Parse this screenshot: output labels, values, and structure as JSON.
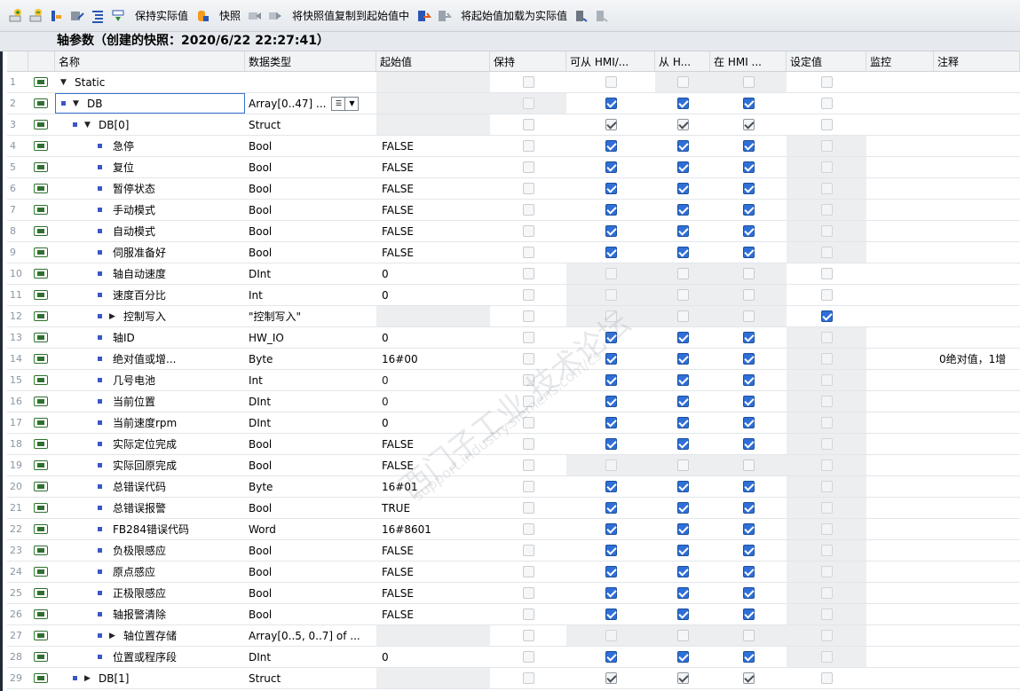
{
  "toolbar": {
    "icons": [
      "insert-row-icon",
      "add-row-icon",
      "reset-icon",
      "update-icon",
      "expand-icon",
      "compare-icon"
    ],
    "keep_actual": "保持实际值",
    "snapshot": "快照",
    "copy_snapshot": "将快照值复制到起始值中",
    "load_start": "将起始值加载为实际值"
  },
  "title": "轴参数（创建的快照：2020/6/22 22:27:41）",
  "headers": {
    "name": "名称",
    "type": "数据类型",
    "start": "起始值",
    "keep": "保持",
    "hmi1": "可从 HMI/...",
    "hmi2": "从 H...",
    "hmi3": "在 HMI ...",
    "setpoint": "设定值",
    "monitor": "监控",
    "comment": "注释"
  },
  "rows": [
    {
      "num": "1",
      "name": "Static",
      "level": 0,
      "marker": "tri-down",
      "type": "",
      "start": "",
      "keep": "off",
      "h1": "off",
      "h2": "off",
      "h3": "off",
      "set": "off",
      "comment": ""
    },
    {
      "num": "2",
      "name": "DB",
      "level": 0,
      "marker": "bullet-tri-down",
      "type": "Array[0..47] ...",
      "start": "",
      "keep": "n",
      "h1": "on",
      "h2": "on",
      "h3": "on",
      "set": "off",
      "comment": ""
    },
    {
      "num": "3",
      "name": "DB[0]",
      "level": 1,
      "marker": "bullet-tri-down",
      "type": "Struct",
      "start": "",
      "keep": "off",
      "h1": "ong",
      "h2": "ong",
      "h3": "ong",
      "set": "off",
      "comment": ""
    },
    {
      "num": "4",
      "name": "急停",
      "level": 2,
      "marker": "bullet",
      "type": "Bool",
      "start": "FALSE",
      "keep": "off",
      "h1": "on",
      "h2": "on",
      "h3": "on",
      "set": "n",
      "comment": ""
    },
    {
      "num": "5",
      "name": "复位",
      "level": 2,
      "marker": "bullet",
      "type": "Bool",
      "start": "FALSE",
      "keep": "off",
      "h1": "on",
      "h2": "on",
      "h3": "on",
      "set": "n",
      "comment": ""
    },
    {
      "num": "6",
      "name": "暂停状态",
      "level": 2,
      "marker": "bullet",
      "type": "Bool",
      "start": "FALSE",
      "keep": "off",
      "h1": "on",
      "h2": "on",
      "h3": "on",
      "set": "n",
      "comment": ""
    },
    {
      "num": "7",
      "name": "手动模式",
      "level": 2,
      "marker": "bullet",
      "type": "Bool",
      "start": "FALSE",
      "keep": "off",
      "h1": "on",
      "h2": "on",
      "h3": "on",
      "set": "n",
      "comment": ""
    },
    {
      "num": "8",
      "name": "自动模式",
      "level": 2,
      "marker": "bullet",
      "type": "Bool",
      "start": "FALSE",
      "keep": "off",
      "h1": "on",
      "h2": "on",
      "h3": "on",
      "set": "n",
      "comment": ""
    },
    {
      "num": "9",
      "name": "伺服准备好",
      "level": 2,
      "marker": "bullet",
      "type": "Bool",
      "start": "FALSE",
      "keep": "off",
      "h1": "on",
      "h2": "on",
      "h3": "on",
      "set": "n",
      "comment": ""
    },
    {
      "num": "10",
      "name": "轴自动速度",
      "level": 2,
      "marker": "bullet",
      "type": "DInt",
      "start": "0",
      "keep": "off",
      "h1": "n",
      "h2": "off",
      "h3": "off",
      "set": "off",
      "comment": ""
    },
    {
      "num": "11",
      "name": "速度百分比",
      "level": 2,
      "marker": "bullet",
      "type": "Int",
      "start": "0",
      "keep": "off",
      "h1": "n",
      "h2": "off",
      "h3": "off",
      "set": "off",
      "comment": ""
    },
    {
      "num": "12",
      "name": "控制写入",
      "level": 2,
      "marker": "bullet-tri-right",
      "type": "\"控制写入\"",
      "start": "",
      "keep": "off",
      "h1": "n",
      "h2": "off",
      "h3": "off",
      "set": "on",
      "comment": ""
    },
    {
      "num": "13",
      "name": "轴ID",
      "level": 2,
      "marker": "bullet",
      "type": "HW_IO",
      "start": "0",
      "keep": "off",
      "h1": "on",
      "h2": "on",
      "h3": "on",
      "set": "n",
      "comment": ""
    },
    {
      "num": "14",
      "name": "绝对值或增...",
      "level": 2,
      "marker": "bullet",
      "type": "Byte",
      "start": "16#00",
      "keep": "off",
      "h1": "on",
      "h2": "on",
      "h3": "on",
      "set": "n",
      "comment": "0绝对值，1增"
    },
    {
      "num": "15",
      "name": "几号电池",
      "level": 2,
      "marker": "bullet",
      "type": "Int",
      "start": "0",
      "keep": "off",
      "h1": "on",
      "h2": "on",
      "h3": "on",
      "set": "n",
      "comment": ""
    },
    {
      "num": "16",
      "name": "当前位置",
      "level": 2,
      "marker": "bullet",
      "type": "DInt",
      "start": "0",
      "keep": "off",
      "h1": "on",
      "h2": "on",
      "h3": "on",
      "set": "n",
      "comment": ""
    },
    {
      "num": "17",
      "name": "当前速度rpm",
      "level": 2,
      "marker": "bullet",
      "type": "DInt",
      "start": "0",
      "keep": "off",
      "h1": "on",
      "h2": "on",
      "h3": "on",
      "set": "n",
      "comment": ""
    },
    {
      "num": "18",
      "name": "实际定位完成",
      "level": 2,
      "marker": "bullet",
      "type": "Bool",
      "start": "FALSE",
      "keep": "off",
      "h1": "on",
      "h2": "on",
      "h3": "on",
      "set": "n",
      "comment": ""
    },
    {
      "num": "19",
      "name": "实际回原完成",
      "level": 2,
      "marker": "bullet",
      "type": "Bool",
      "start": "FALSE",
      "keep": "off",
      "h1": "n",
      "h2": "off",
      "h3": "off",
      "set": "n",
      "comment": ""
    },
    {
      "num": "20",
      "name": "总错误代码",
      "level": 2,
      "marker": "bullet",
      "type": "Byte",
      "start": "16#01",
      "keep": "off",
      "h1": "on",
      "h2": "on",
      "h3": "on",
      "set": "n",
      "comment": ""
    },
    {
      "num": "21",
      "name": "总错误报警",
      "level": 2,
      "marker": "bullet",
      "type": "Bool",
      "start": "TRUE",
      "keep": "off",
      "h1": "on",
      "h2": "on",
      "h3": "on",
      "set": "n",
      "comment": ""
    },
    {
      "num": "22",
      "name": "FB284错误代码",
      "level": 2,
      "marker": "bullet",
      "type": "Word",
      "start": "16#8601",
      "keep": "off",
      "h1": "on",
      "h2": "on",
      "h3": "on",
      "set": "n",
      "comment": ""
    },
    {
      "num": "23",
      "name": "负极限感应",
      "level": 2,
      "marker": "bullet",
      "type": "Bool",
      "start": "FALSE",
      "keep": "off",
      "h1": "on",
      "h2": "on",
      "h3": "on",
      "set": "n",
      "comment": ""
    },
    {
      "num": "24",
      "name": "原点感应",
      "level": 2,
      "marker": "bullet",
      "type": "Bool",
      "start": "FALSE",
      "keep": "off",
      "h1": "on",
      "h2": "on",
      "h3": "on",
      "set": "n",
      "comment": ""
    },
    {
      "num": "25",
      "name": "正极限感应",
      "level": 2,
      "marker": "bullet",
      "type": "Bool",
      "start": "FALSE",
      "keep": "off",
      "h1": "on",
      "h2": "on",
      "h3": "on",
      "set": "n",
      "comment": ""
    },
    {
      "num": "26",
      "name": "轴报警清除",
      "level": 2,
      "marker": "bullet",
      "type": "Bool",
      "start": "FALSE",
      "keep": "off",
      "h1": "on",
      "h2": "on",
      "h3": "on",
      "set": "n",
      "comment": ""
    },
    {
      "num": "27",
      "name": "轴位置存储",
      "level": 2,
      "marker": "bullet-tri-right",
      "type": "Array[0..5, 0..7] of ...",
      "start": "",
      "keep": "off",
      "h1": "n",
      "h2": "off",
      "h3": "off",
      "set": "n",
      "comment": ""
    },
    {
      "num": "28",
      "name": "位置或程序段",
      "level": 2,
      "marker": "bullet",
      "type": "DInt",
      "start": "0",
      "keep": "off",
      "h1": "on",
      "h2": "on",
      "h3": "on",
      "set": "n",
      "comment": ""
    },
    {
      "num": "29",
      "name": "DB[1]",
      "level": 1,
      "marker": "bullet-tri-right",
      "type": "Struct",
      "start": "",
      "keep": "off",
      "h1": "ong",
      "h2": "ong",
      "h3": "ong",
      "set": "off",
      "comment": ""
    }
  ],
  "watermark": {
    "line1": "西门子工业 技术论坛",
    "line2": "support.industry.siemens.com/cs"
  }
}
